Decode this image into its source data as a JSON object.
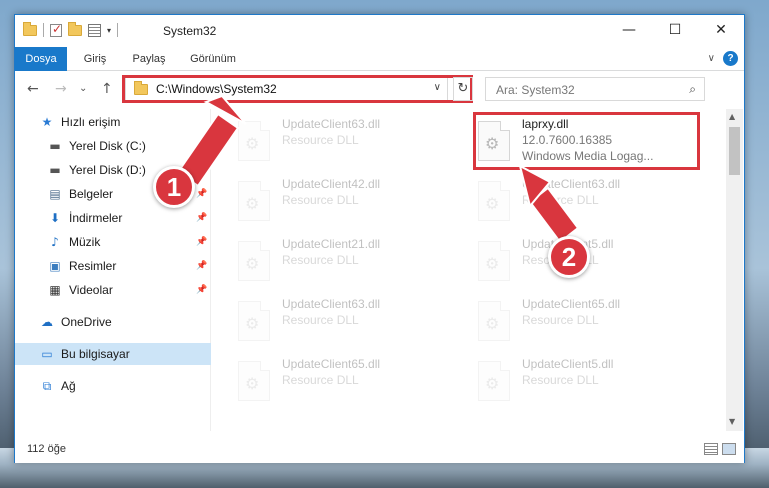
{
  "window": {
    "title": "System32",
    "controls": {
      "minimize": "—",
      "maximize": "☐",
      "close": "✕"
    }
  },
  "quick_access_toolbar": {
    "dropdown": "▾"
  },
  "ribbon": {
    "tabs": [
      "Dosya",
      "Giriş",
      "Paylaş",
      "Görünüm"
    ],
    "expand_chevron": "∨",
    "help": "?"
  },
  "nav": {
    "back": "←",
    "forward": "→",
    "recent": "⌄",
    "up": "↑",
    "address": "C:\\Windows\\System32",
    "address_dropdown": "∨",
    "refresh": "↻",
    "search_placeholder": "Ara: System32",
    "search_icon": "⌕"
  },
  "sidebar": {
    "items": [
      {
        "label": "Hızlı erişim",
        "icon": "star-icon",
        "glyph": "★",
        "color": "#2a7bd4",
        "pinned": false
      },
      {
        "label": "Yerel Disk (C:)",
        "icon": "drive-icon",
        "glyph": "▬",
        "color": "#555555",
        "pinned": true
      },
      {
        "label": "Yerel Disk (D:)",
        "icon": "drive-icon",
        "glyph": "▬",
        "color": "#555555",
        "pinned": true
      },
      {
        "label": "Belgeler",
        "icon": "documents-icon",
        "glyph": "▤",
        "color": "#4a6a8a",
        "pinned": true
      },
      {
        "label": "İndirmeler",
        "icon": "download-icon",
        "glyph": "⬇",
        "color": "#1e6fc4",
        "pinned": true
      },
      {
        "label": "Müzik",
        "icon": "music-icon",
        "glyph": "♪",
        "color": "#1e6fc4",
        "pinned": true
      },
      {
        "label": "Resimler",
        "icon": "pictures-icon",
        "glyph": "▣",
        "color": "#3c7dbf",
        "pinned": true
      },
      {
        "label": "Videolar",
        "icon": "video-icon",
        "glyph": "▦",
        "color": "#333333",
        "pinned": true
      },
      {
        "label": "OneDrive",
        "icon": "cloud-icon",
        "glyph": "☁",
        "color": "#1e6fc4",
        "pinned": false
      },
      {
        "label": "Bu bilgisayar",
        "icon": "computer-icon",
        "glyph": "▭",
        "color": "#2a7bd4",
        "pinned": false,
        "selected": true
      },
      {
        "label": "Ağ",
        "icon": "network-icon",
        "glyph": "⧉",
        "color": "#2a7bd4",
        "pinned": false
      }
    ],
    "pin_glyph": "📌"
  },
  "files": [
    {
      "name": "UpdateClient63.dll",
      "line2": "Resource DLL",
      "line3": "",
      "faded": true
    },
    {
      "name": "laprxy.dll",
      "line2": "12.0.7600.16385",
      "line3": "Windows Media Logag...",
      "faded": false,
      "highlighted": true
    },
    {
      "name": "UpdateClient42.dll",
      "line2": "Resource DLL",
      "line3": "",
      "faded": true
    },
    {
      "name": "UpdateClient63.dll",
      "line2": "Resource DLL",
      "line3": "",
      "faded": true
    },
    {
      "name": "UpdateClient21.dll",
      "line2": "Resource DLL",
      "line3": "",
      "faded": true
    },
    {
      "name": "UpdateClient5.dll",
      "line2": "Resource DLL",
      "line3": "",
      "faded": true
    },
    {
      "name": "UpdateClient63.dll",
      "line2": "Resource DLL",
      "line3": "",
      "faded": true
    },
    {
      "name": "UpdateClient65.dll",
      "line2": "Resource DLL",
      "line3": "",
      "faded": true
    },
    {
      "name": "UpdateClient65.dll",
      "line2": "Resource DLL",
      "line3": "",
      "faded": true
    },
    {
      "name": "UpdateClient5.dll",
      "line2": "Resource DLL",
      "line3": "",
      "faded": true
    }
  ],
  "scrollbar": {
    "up": "▲",
    "down": "▼"
  },
  "status": {
    "item_count": "112 öğe"
  },
  "annotations": [
    {
      "number": "1",
      "color": "#d9363e"
    },
    {
      "number": "2",
      "color": "#d9363e"
    }
  ]
}
